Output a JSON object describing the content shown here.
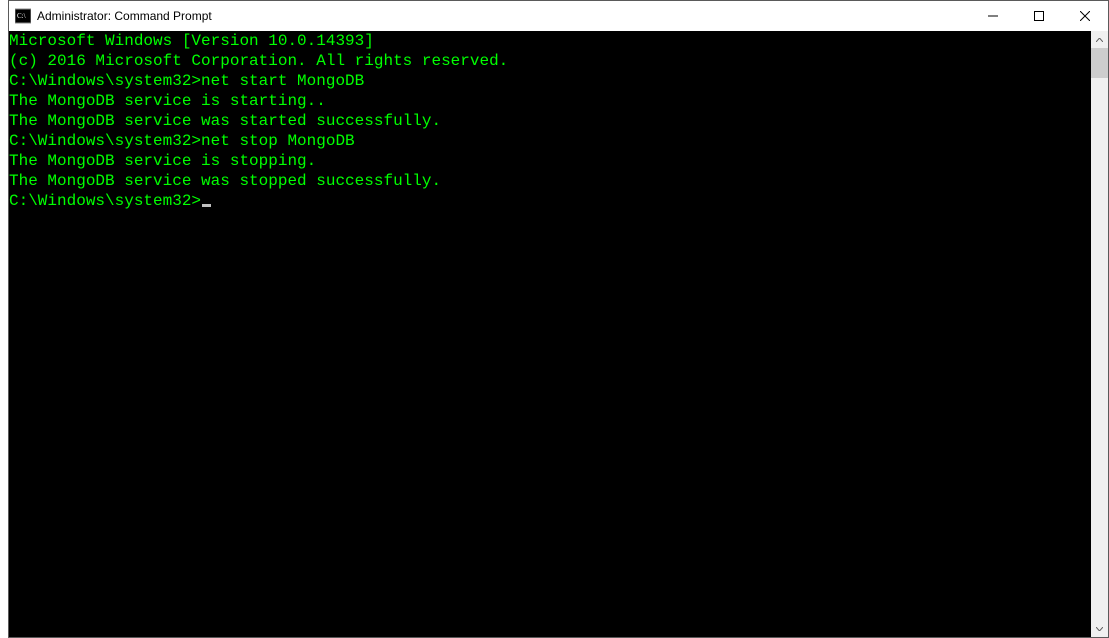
{
  "window": {
    "title": "Administrator: Command Prompt"
  },
  "terminal": {
    "lines": [
      "Microsoft Windows [Version 10.0.14393]",
      "(c) 2016 Microsoft Corporation. All rights reserved.",
      "",
      "C:\\Windows\\system32>net start MongoDB",
      "The MongoDB service is starting..",
      "The MongoDB service was started successfully.",
      "",
      "",
      "C:\\Windows\\system32>net stop MongoDB",
      "The MongoDB service is stopping.",
      "The MongoDB service was stopped successfully.",
      "",
      "",
      "C:\\Windows\\system32>"
    ],
    "prompt": "C:\\Windows\\system32>",
    "commands": [
      "net start MongoDB",
      "net stop MongoDB"
    ],
    "text_color": "#00ff00",
    "background": "#000000"
  }
}
